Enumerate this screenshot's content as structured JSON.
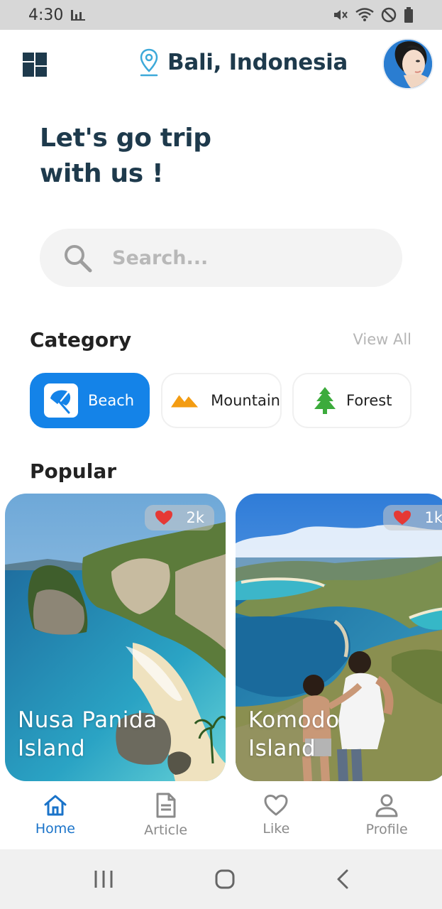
{
  "status_bar": {
    "time": "4:30"
  },
  "header": {
    "location": "Bali, Indonesia"
  },
  "headline": "Let's go trip\nwith us !",
  "search": {
    "placeholder": "Search..."
  },
  "category": {
    "title": "Category",
    "view_all": "View All",
    "items": [
      {
        "label": "Beach",
        "icon": "umbrella-icon",
        "active": true,
        "color": "#1483e8"
      },
      {
        "label": "Mountain",
        "icon": "mountain-icon",
        "active": false,
        "color": "#f39c12"
      },
      {
        "label": "Forest",
        "icon": "tree-icon",
        "active": false,
        "color": "#3cab3c"
      }
    ]
  },
  "popular": {
    "title": "Popular",
    "cards": [
      {
        "title": "Nusa Panida\nIsland",
        "likes": "2k"
      },
      {
        "title": "Komodo\nIsland",
        "likes": "1k"
      }
    ]
  },
  "bottom_nav": {
    "items": [
      {
        "label": "Home",
        "icon": "home-icon",
        "active": true
      },
      {
        "label": "Article",
        "icon": "document-icon",
        "active": false
      },
      {
        "label": "Like",
        "icon": "heart-icon",
        "active": false
      },
      {
        "label": "Profile",
        "icon": "person-icon",
        "active": false
      }
    ]
  },
  "colors": {
    "accent": "#1483e8",
    "heading": "#1e3a4c",
    "like": "#e53935"
  }
}
